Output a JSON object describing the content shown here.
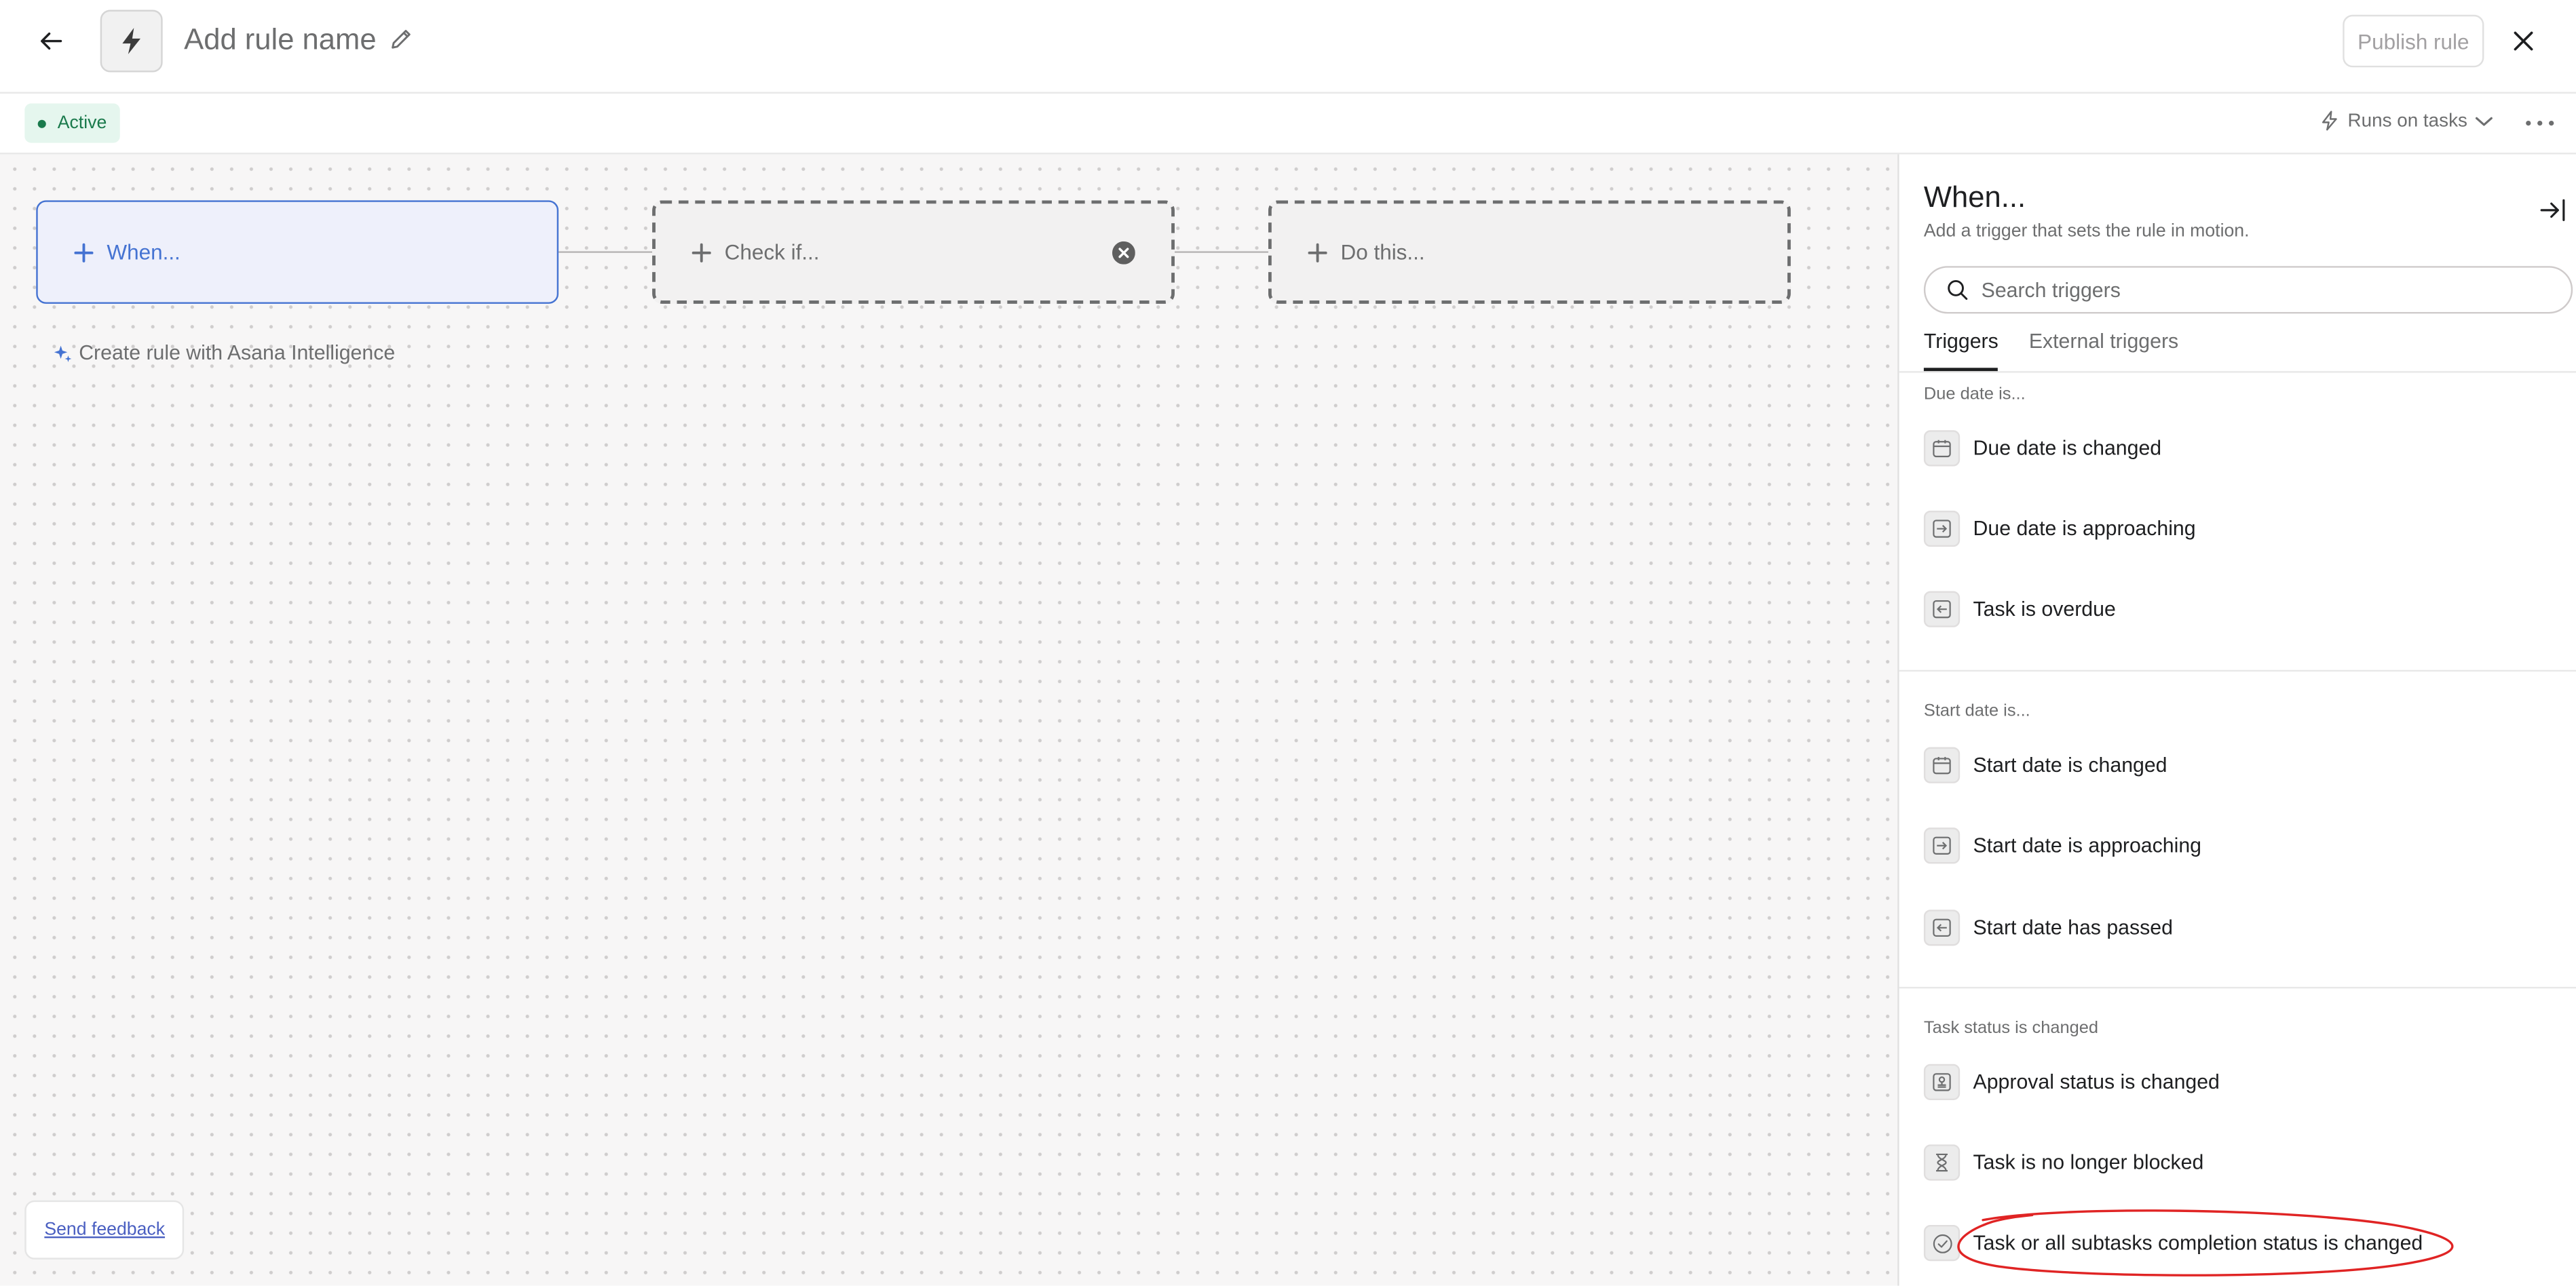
{
  "header": {
    "rule_name_placeholder": "Add rule name",
    "publish_label": "Publish rule"
  },
  "subheader": {
    "status": "Active",
    "runs_on_label": "Runs on tasks"
  },
  "canvas": {
    "when_label": "When...",
    "check_label": "Check if...",
    "do_label": "Do this...",
    "ai_label": "Create rule with Asana Intelligence",
    "feedback_label": "Send feedback"
  },
  "panel": {
    "title": "When...",
    "subtitle": "Add a trigger that sets the rule in motion.",
    "search_placeholder": "Search triggers",
    "tabs": [
      "Triggers",
      "External triggers"
    ],
    "sections": [
      {
        "label": "Due date is...",
        "items": [
          {
            "label": "Due date is changed",
            "icon": "calendar-icon"
          },
          {
            "label": "Due date is approaching",
            "icon": "arrow-in-icon"
          },
          {
            "label": "Task is overdue",
            "icon": "arrow-out-icon"
          }
        ]
      },
      {
        "label": "Start date is...",
        "items": [
          {
            "label": "Start date is changed",
            "icon": "calendar-icon"
          },
          {
            "label": "Start date is approaching",
            "icon": "arrow-in-icon"
          },
          {
            "label": "Start date has passed",
            "icon": "arrow-out-icon"
          }
        ]
      },
      {
        "label": "Task status is changed",
        "items": [
          {
            "label": "Approval status is changed",
            "icon": "stamp-icon"
          },
          {
            "label": "Task is no longer blocked",
            "icon": "hourglass-icon"
          },
          {
            "label": "Task or all subtasks completion status is changed",
            "icon": "check-circle-icon"
          }
        ]
      }
    ]
  },
  "colors": {
    "accent": "#4573d2",
    "annotation": "#e02424",
    "active_badge": "#e5f6ee"
  }
}
